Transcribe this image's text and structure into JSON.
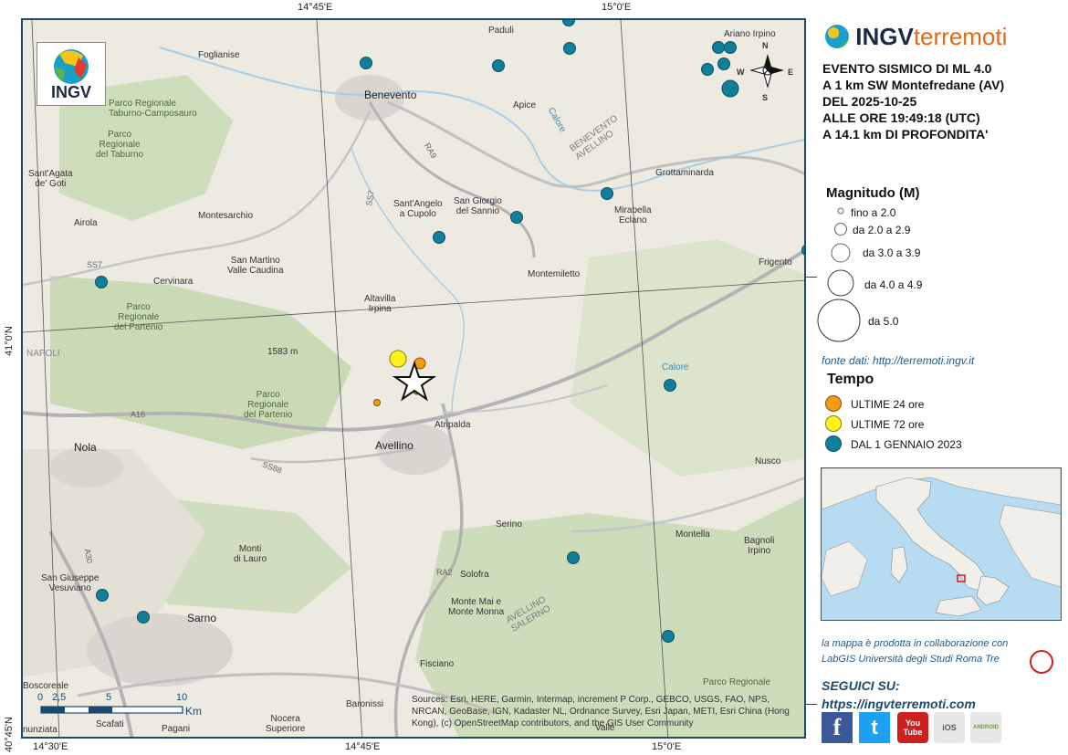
{
  "grid_labels": {
    "top": [
      "14°45'E",
      "15°0'E"
    ],
    "bottom": [
      "14°30'E",
      "14°45'E",
      "15°0'E"
    ],
    "left": [
      "41°0'N",
      "40°45'N"
    ]
  },
  "logo_text": "INGV",
  "places": {
    "benevento": "Benevento",
    "avellino": "Avellino",
    "nola": "Nola",
    "sarno": "Sarno",
    "foglianise": "Foglianise",
    "paduli": "Paduli",
    "apice": "Apice",
    "ariano": "Ariano Irpino",
    "grottaminarda": "Grottaminarda",
    "mirabella": "Mirabella\nEclano",
    "santagata": "Sant'Agata\nde' Goti",
    "airola": "Airola",
    "montesarchio": "Montesarchio",
    "santangelo": "Sant'Angelo\na Cupolo",
    "sangiorgio": "San Giorgio\ndel Sannio",
    "sanmartino": "San Martino\nValle Caudina",
    "cervinara": "Cervinara",
    "montemiletto": "Montemiletto",
    "frigento": "Frigento",
    "altavilla": "Altavilla\nIrpina",
    "atripalda": "Atripalda",
    "nusco": "Nusco",
    "serino": "Serino",
    "montella": "Montella",
    "bagnoli": "Bagnoli\nIrpino",
    "montidilauro": "Monti\ndi Lauro",
    "solofra": "Solofra",
    "sangiuseppe": "San Giuseppe\nVesuviano",
    "montemai": "Monte Mai e\nMonte Monna",
    "fisciano": "Fisciano",
    "baronissi": "Baronissi",
    "pagani": "Pagani",
    "scafati": "Scafati",
    "nocera": "Nocera\nSuperiore",
    "boscoreale": "Boscoreale",
    "nunziata": "nunziata",
    "vietri": "Valle",
    "park_taburno": "Parco Regionale\nTaburno-Camposauro",
    "park_taburno2": "Parco\nRegionale\ndel Taburno",
    "park_partenio1": "Parco\nRegionale\ndel Partenio",
    "park_partenio2": "Parco\nRegionale\ndel Partenio",
    "park_monti": "Parco Regionale",
    "benevento_prov": "BENEVENTO\nAVELLINO",
    "avellino_prov": "AVELLINO\nSALERNO",
    "calore1": "Calore",
    "calore2": "Calore",
    "peak": "1583 m",
    "napoli": "NAPOLI"
  },
  "roads": {
    "ss7": "SS7",
    "a16": "A16",
    "ra9": "RA9",
    "ss88": "SS88",
    "ra2": "RA2",
    "a30": "A30",
    "ss7b": "SS7"
  },
  "scale_bar": {
    "labels": [
      "0",
      "2,5",
      "5",
      "10"
    ],
    "unit": "Km"
  },
  "attribution": "Sources: Esri, HERE, Garmin, Intermap, increment P Corp., GEBCO, USGS, FAO, NPS, NRCAN, GeoBase, IGN, Kadaster NL, Ordnance Survey, Esri Japan, METI, Esri China (Hong Kong), (c) OpenStreetMap contributors, and the GIS User Community",
  "compass": {
    "n": "N",
    "s": "S",
    "e": "E",
    "w": "W"
  },
  "brand": {
    "ingv": "INGV",
    "terremoti": "terremoti"
  },
  "event_lines": [
    "EVENTO SISMICO DI ML 4.0",
    "A 1 km SW Montefredane (AV)",
    "DEL 2025-10-25",
    "ALLE ORE 19:49:18 (UTC)",
    "A 14.1 km DI PROFONDITA'"
  ],
  "magnitude_legend": {
    "title": "Magnitudo (M)",
    "items": [
      "fino a 2.0",
      "da 2.0 a 2.9",
      "da 3.0 a 3.9",
      "da 4.0 a 4.9",
      "da 5.0"
    ]
  },
  "data_source": "fonte dati: http://terremoti.ingv.it",
  "time_legend": {
    "title": "Tempo",
    "items": [
      {
        "label": "ULTIME 24 ore",
        "color": "#f39a16"
      },
      {
        "label": "ULTIME 72 ore",
        "color": "#fff21c"
      },
      {
        "label": "DAL 1 GENNAIO 2023",
        "color": "#127f9a"
      }
    ]
  },
  "collab": [
    "la mappa è prodotta in collaborazione con",
    "LabGIS Università degli Studi Roma Tre"
  ],
  "follow": {
    "title": "SEGUICI SU:",
    "url": "https://ingvterremoti.com"
  },
  "social": {
    "facebook": "f",
    "twitter": "t",
    "youtube": "You\nTube",
    "ios": "iOS",
    "android": "ANDROID"
  },
  "colors": {
    "frame": "#1c4a6e",
    "recent24": "#f39a16",
    "recent72": "#fff21c",
    "since2023": "#127f9a",
    "brand_orange": "#e06a1a"
  }
}
